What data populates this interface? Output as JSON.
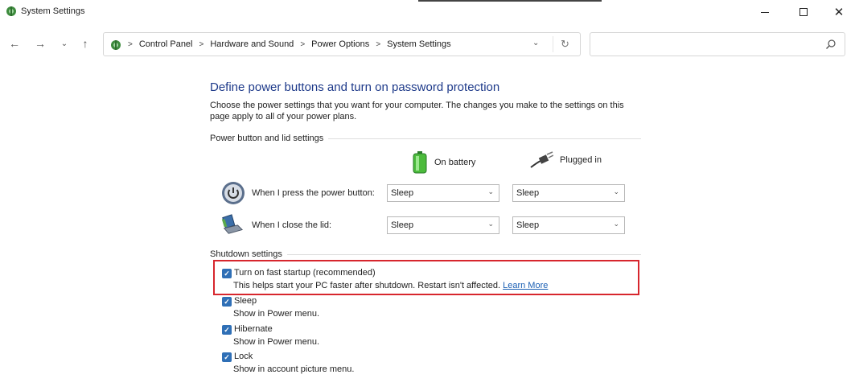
{
  "window": {
    "title": "System Settings"
  },
  "nav": {
    "breadcrumbs": [
      "Control Panel",
      "Hardware and Sound",
      "Power Options",
      "System Settings"
    ],
    "search_placeholder": ""
  },
  "page": {
    "heading": "Define power buttons and turn on password protection",
    "description": "Choose the power settings that you want for your computer. The changes you make to the settings on this page apply to all of your power plans.",
    "power_section_label": "Power button and lid settings",
    "columns": {
      "battery": "On battery",
      "plugged": "Plugged in"
    },
    "rows": [
      {
        "label": "When I press the power button:",
        "battery": "Sleep",
        "plugged": "Sleep"
      },
      {
        "label": "When I close the lid:",
        "battery": "Sleep",
        "plugged": "Sleep"
      }
    ],
    "shutdown_section_label": "Shutdown settings",
    "shutdown_options": [
      {
        "label": "Turn on fast startup (recommended)",
        "desc": "This helps start your PC faster after shutdown. Restart isn't affected.",
        "link": "Learn More",
        "checked": true
      },
      {
        "label": "Sleep",
        "desc": "Show in Power menu.",
        "checked": true
      },
      {
        "label": "Hibernate",
        "desc": "Show in Power menu.",
        "checked": true
      },
      {
        "label": "Lock",
        "desc": "Show in account picture menu.",
        "checked": true
      }
    ]
  },
  "colors": {
    "heading": "#1e3a8a",
    "checkbox": "#2f6fb6",
    "highlight": "#d7262d",
    "link": "#1a5fb4"
  }
}
